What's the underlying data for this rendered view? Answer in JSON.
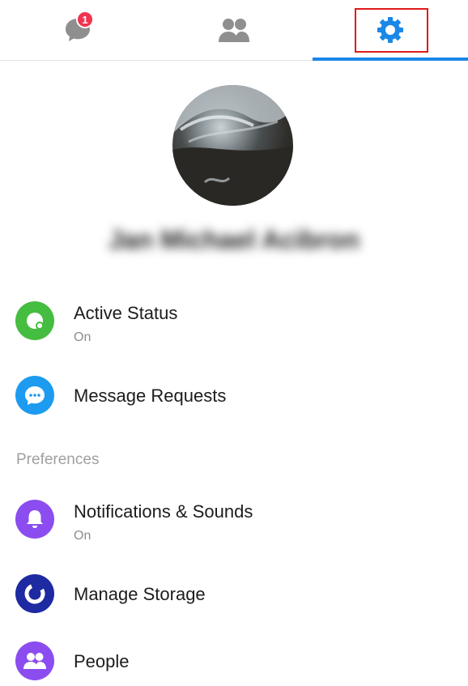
{
  "tabs": {
    "chats_badge": "1",
    "items": [
      {
        "icon": "chat-bubble-icon"
      },
      {
        "icon": "people-icon"
      },
      {
        "icon": "gear-icon"
      }
    ],
    "active_color": "#1b87e6"
  },
  "profile": {
    "name": "Jan Michael Acibron"
  },
  "menu": {
    "active_status": {
      "label": "Active Status",
      "sub": "On",
      "color": "#45bd41"
    },
    "message_requests": {
      "label": "Message Requests",
      "color": "#1d9bf0"
    },
    "section_preferences": "Preferences",
    "notifications": {
      "label": "Notifications & Sounds",
      "sub": "On",
      "color": "#8b4df0"
    },
    "manage_storage": {
      "label": "Manage Storage",
      "color": "#1d2aa1"
    },
    "people": {
      "label": "People",
      "color": "#8b4df0"
    }
  }
}
